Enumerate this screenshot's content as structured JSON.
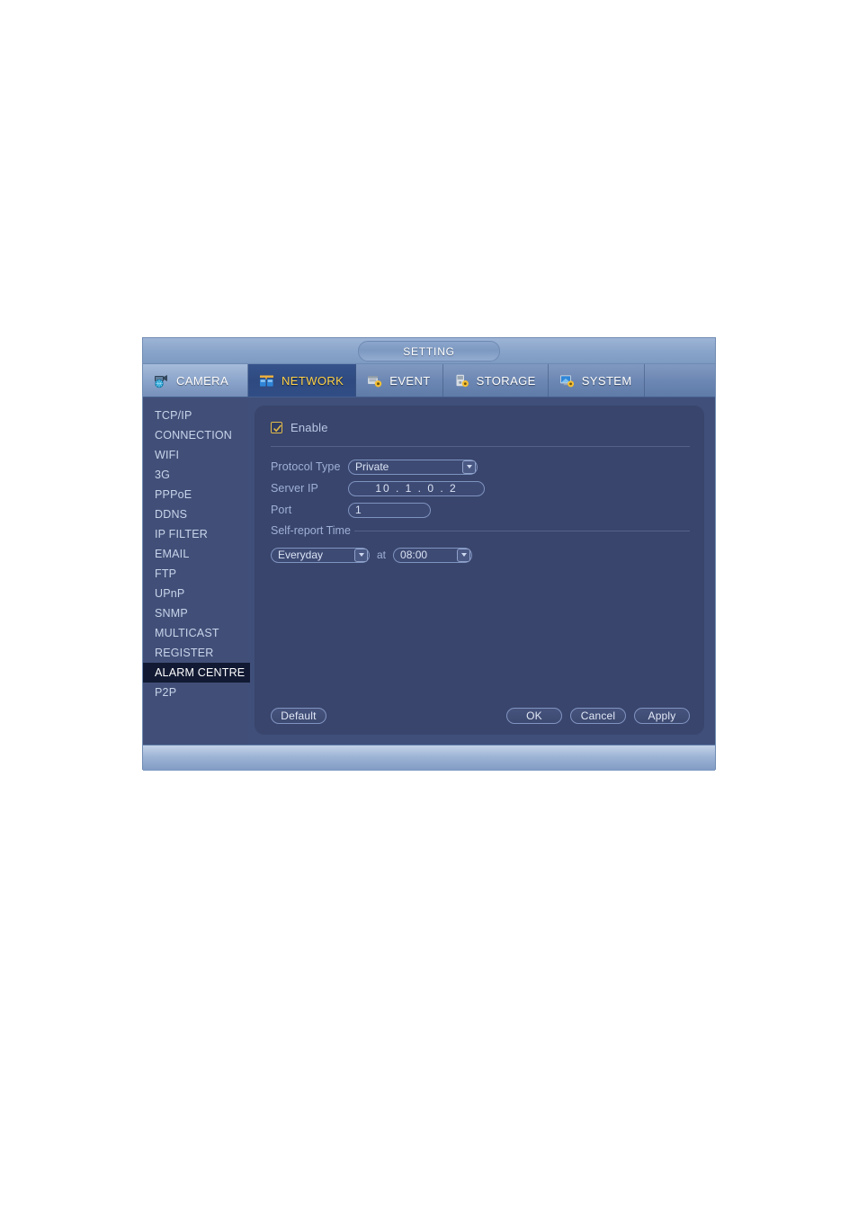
{
  "window": {
    "title": "SETTING"
  },
  "tabs": [
    {
      "label": "CAMERA",
      "icon": "camera-globe-icon",
      "active": false
    },
    {
      "label": "NETWORK",
      "icon": "network-icon",
      "active": true
    },
    {
      "label": "EVENT",
      "icon": "event-gear-icon",
      "active": false
    },
    {
      "label": "STORAGE",
      "icon": "storage-gear-icon",
      "active": false
    },
    {
      "label": "SYSTEM",
      "icon": "system-gear-icon",
      "active": false
    }
  ],
  "sidebar": {
    "items": [
      {
        "label": "TCP/IP",
        "selected": false
      },
      {
        "label": "CONNECTION",
        "selected": false
      },
      {
        "label": "WIFI",
        "selected": false
      },
      {
        "label": "3G",
        "selected": false
      },
      {
        "label": "PPPoE",
        "selected": false
      },
      {
        "label": "DDNS",
        "selected": false
      },
      {
        "label": "IP FILTER",
        "selected": false
      },
      {
        "label": "EMAIL",
        "selected": false
      },
      {
        "label": "FTP",
        "selected": false
      },
      {
        "label": "UPnP",
        "selected": false
      },
      {
        "label": "SNMP",
        "selected": false
      },
      {
        "label": "MULTICAST",
        "selected": false
      },
      {
        "label": "REGISTER",
        "selected": false
      },
      {
        "label": "ALARM CENTRE",
        "selected": true
      },
      {
        "label": "P2P",
        "selected": false
      }
    ]
  },
  "form": {
    "enable": {
      "label": "Enable",
      "checked": true
    },
    "protocol_type": {
      "label": "Protocol Type",
      "value": "Private"
    },
    "server_ip": {
      "label": "Server IP",
      "value": "10  .   1   .   0   .   2"
    },
    "port": {
      "label": "Port",
      "value": "1"
    },
    "self_report": {
      "label": "Self-report Time"
    },
    "day": {
      "value": "Everyday"
    },
    "at_label": "at",
    "time": {
      "value": "08:00"
    }
  },
  "buttons": {
    "default": "Default",
    "ok": "OK",
    "cancel": "Cancel",
    "apply": "Apply"
  },
  "colors": {
    "accent_yellow": "#ffd24a",
    "panel_bg": "#39456c",
    "sidebar_bg": "#414f78",
    "selected_bg": "#121a33",
    "tab_active_bg": "#2e4a80",
    "field_border": "#7e93c0",
    "label_text": "#9fb0d6"
  }
}
